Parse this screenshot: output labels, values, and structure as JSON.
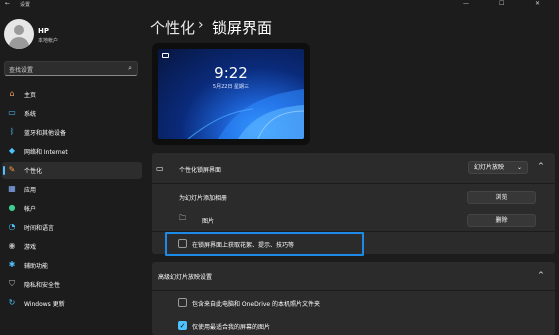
{
  "titlebar": {
    "back": "←",
    "title": "设置",
    "minimize": "—",
    "maximize": "☐",
    "close": "✕"
  },
  "user": {
    "name": "HP",
    "account": "本地帐户"
  },
  "search": {
    "placeholder": "查找设置",
    "icon": "search-icon"
  },
  "nav": [
    {
      "label": "主页",
      "icon": "home-icon",
      "color": "#e89c5b"
    },
    {
      "label": "系统",
      "icon": "monitor-icon",
      "color": "#4cc2ff"
    },
    {
      "label": "蓝牙和其他设备",
      "icon": "bluetooth-icon",
      "color": "#4cc2ff"
    },
    {
      "label": "网络和 Internet",
      "icon": "wifi-icon",
      "color": "#4cc2ff"
    },
    {
      "label": "个性化",
      "icon": "pen-icon",
      "color": "#ff9a3c",
      "active": true
    },
    {
      "label": "应用",
      "icon": "apps-icon",
      "color": "#8ab4ff"
    },
    {
      "label": "帐户",
      "icon": "person-icon",
      "color": "#3ccf8e"
    },
    {
      "label": "时间和语言",
      "icon": "globe-clock-icon",
      "color": "#4cc2ff"
    },
    {
      "label": "游戏",
      "icon": "gamepad-icon",
      "color": "#b8b8b8"
    },
    {
      "label": "辅助功能",
      "icon": "accessibility-icon",
      "color": "#4cc2ff"
    },
    {
      "label": "隐私和安全性",
      "icon": "shield-icon",
      "color": "#b8b8b8"
    },
    {
      "label": "Windows 更新",
      "icon": "update-icon",
      "color": "#4cc2ff"
    }
  ],
  "breadcrumb": {
    "parent": "个性化",
    "separator": "›",
    "current": "锁屏界面"
  },
  "preview": {
    "time": "9:22",
    "date": "5月22日 星期三"
  },
  "personalize": {
    "label": "个性化锁屏界面",
    "dropdown_value": "幻灯片放映",
    "chevron": "^",
    "add_album_label": "为幻灯片添加相册",
    "browse_label": "浏览",
    "folder_label": "图片",
    "remove_label": "删除",
    "tips_label": "在锁屏界面上获取花絮、提示、技巧等",
    "tips_checked": false
  },
  "advanced": {
    "label": "高级幻灯片放映设置",
    "onedrive_label": "包含来自此电脑和 OneDrive 的本机照片文件夹",
    "onedrive_checked": false,
    "fit_label": "仅使用最适合我的屏幕的图片",
    "fit_checked": true
  },
  "colors": {
    "accent": "#4cc2ff",
    "highlight_border": "#1e8ae8",
    "background": "#1c1c1c",
    "card": "#2b2b2b"
  }
}
